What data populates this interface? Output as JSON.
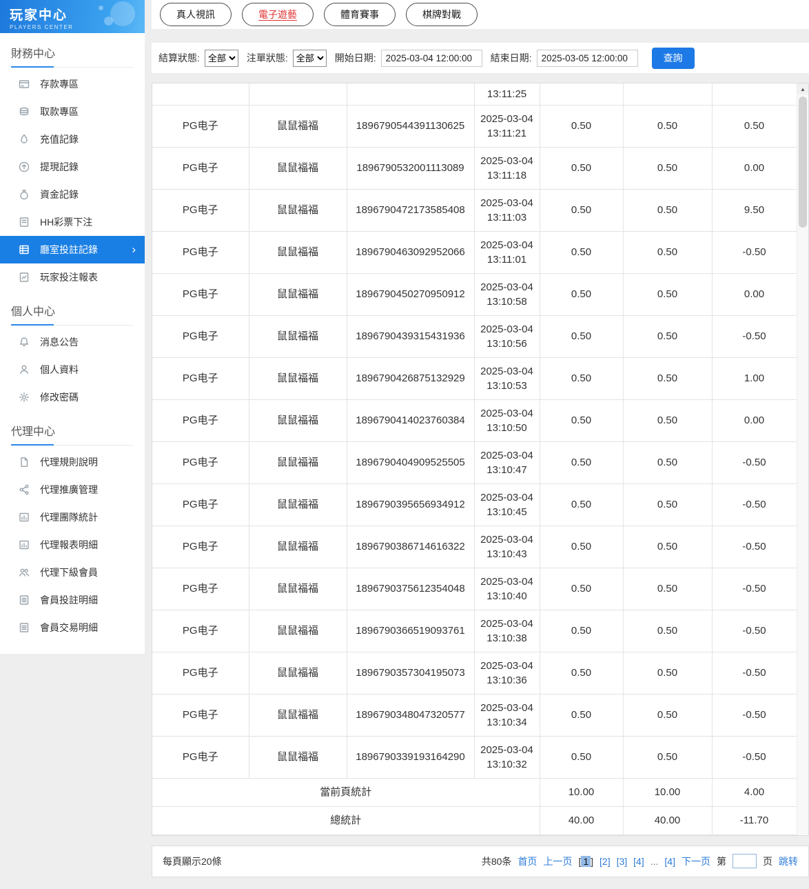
{
  "sidebar": {
    "title": "玩家中心",
    "subtitle": "PLAYERS CENTER",
    "sections": [
      {
        "label": "財務中心",
        "items": [
          {
            "label": "存款專區",
            "icon": "deposit"
          },
          {
            "label": "取款專區",
            "icon": "withdraw"
          },
          {
            "label": "充值記錄",
            "icon": "recharge"
          },
          {
            "label": "提現記錄",
            "icon": "cashout"
          },
          {
            "label": "資金記錄",
            "icon": "funds"
          },
          {
            "label": "HH彩票下注",
            "icon": "lottery"
          },
          {
            "label": "廳室投註記錄",
            "icon": "betting",
            "active": true
          },
          {
            "label": "玩家投注報表",
            "icon": "report"
          }
        ]
      },
      {
        "label": "個人中心",
        "items": [
          {
            "label": "消息公告",
            "icon": "bell"
          },
          {
            "label": "個人資料",
            "icon": "user"
          },
          {
            "label": "修改密碼",
            "icon": "gear"
          }
        ]
      },
      {
        "label": "代理中心",
        "items": [
          {
            "label": "代理規則說明",
            "icon": "doc"
          },
          {
            "label": "代理推廣管理",
            "icon": "share"
          },
          {
            "label": "代理團隊統計",
            "icon": "chart"
          },
          {
            "label": "代理報表明細",
            "icon": "chart"
          },
          {
            "label": "代理下級會員",
            "icon": "users"
          },
          {
            "label": "會員投註明細",
            "icon": "list"
          },
          {
            "label": "會員交易明細",
            "icon": "list"
          }
        ]
      }
    ]
  },
  "tabs": [
    {
      "label": "真人視訊",
      "active": false
    },
    {
      "label": "電子遊藝",
      "active": true
    },
    {
      "label": "體育賽事",
      "active": false
    },
    {
      "label": "棋牌對戰",
      "active": false
    }
  ],
  "filters": {
    "settle_status_label": "結算狀態:",
    "settle_status_value": "全部",
    "order_status_label": "注單狀態:",
    "order_status_value": "全部",
    "start_label": "開始日期:",
    "start_value": "2025-03-04 12:00:00",
    "end_label": "結束日期:",
    "end_value": "2025-03-05 12:00:00",
    "search_label": "查詢"
  },
  "table": {
    "partial_row_time": "13:11:25",
    "rows": [
      {
        "provider": "PG电子",
        "game": "鼠鼠福福",
        "order": "1896790544391130625",
        "date": "2025-03-04",
        "time": "13:11:21",
        "bet": "0.50",
        "valid": "0.50",
        "payout": "0.50"
      },
      {
        "provider": "PG电子",
        "game": "鼠鼠福福",
        "order": "1896790532001113089",
        "date": "2025-03-04",
        "time": "13:11:18",
        "bet": "0.50",
        "valid": "0.50",
        "payout": "0.00"
      },
      {
        "provider": "PG电子",
        "game": "鼠鼠福福",
        "order": "1896790472173585408",
        "date": "2025-03-04",
        "time": "13:11:03",
        "bet": "0.50",
        "valid": "0.50",
        "payout": "9.50"
      },
      {
        "provider": "PG电子",
        "game": "鼠鼠福福",
        "order": "1896790463092952066",
        "date": "2025-03-04",
        "time": "13:11:01",
        "bet": "0.50",
        "valid": "0.50",
        "payout": "-0.50"
      },
      {
        "provider": "PG电子",
        "game": "鼠鼠福福",
        "order": "1896790450270950912",
        "date": "2025-03-04",
        "time": "13:10:58",
        "bet": "0.50",
        "valid": "0.50",
        "payout": "0.00"
      },
      {
        "provider": "PG电子",
        "game": "鼠鼠福福",
        "order": "1896790439315431936",
        "date": "2025-03-04",
        "time": "13:10:56",
        "bet": "0.50",
        "valid": "0.50",
        "payout": "-0.50"
      },
      {
        "provider": "PG电子",
        "game": "鼠鼠福福",
        "order": "1896790426875132929",
        "date": "2025-03-04",
        "time": "13:10:53",
        "bet": "0.50",
        "valid": "0.50",
        "payout": "1.00"
      },
      {
        "provider": "PG电子",
        "game": "鼠鼠福福",
        "order": "1896790414023760384",
        "date": "2025-03-04",
        "time": "13:10:50",
        "bet": "0.50",
        "valid": "0.50",
        "payout": "0.00"
      },
      {
        "provider": "PG电子",
        "game": "鼠鼠福福",
        "order": "1896790404909525505",
        "date": "2025-03-04",
        "time": "13:10:47",
        "bet": "0.50",
        "valid": "0.50",
        "payout": "-0.50"
      },
      {
        "provider": "PG电子",
        "game": "鼠鼠福福",
        "order": "1896790395656934912",
        "date": "2025-03-04",
        "time": "13:10:45",
        "bet": "0.50",
        "valid": "0.50",
        "payout": "-0.50"
      },
      {
        "provider": "PG电子",
        "game": "鼠鼠福福",
        "order": "1896790386714616322",
        "date": "2025-03-04",
        "time": "13:10:43",
        "bet": "0.50",
        "valid": "0.50",
        "payout": "-0.50"
      },
      {
        "provider": "PG电子",
        "game": "鼠鼠福福",
        "order": "1896790375612354048",
        "date": "2025-03-04",
        "time": "13:10:40",
        "bet": "0.50",
        "valid": "0.50",
        "payout": "-0.50"
      },
      {
        "provider": "PG电子",
        "game": "鼠鼠福福",
        "order": "1896790366519093761",
        "date": "2025-03-04",
        "time": "13:10:38",
        "bet": "0.50",
        "valid": "0.50",
        "payout": "-0.50"
      },
      {
        "provider": "PG电子",
        "game": "鼠鼠福福",
        "order": "1896790357304195073",
        "date": "2025-03-04",
        "time": "13:10:36",
        "bet": "0.50",
        "valid": "0.50",
        "payout": "-0.50"
      },
      {
        "provider": "PG电子",
        "game": "鼠鼠福福",
        "order": "1896790348047320577",
        "date": "2025-03-04",
        "time": "13:10:34",
        "bet": "0.50",
        "valid": "0.50",
        "payout": "-0.50"
      },
      {
        "provider": "PG电子",
        "game": "鼠鼠福福",
        "order": "1896790339193164290",
        "date": "2025-03-04",
        "time": "13:10:32",
        "bet": "0.50",
        "valid": "0.50",
        "payout": "-0.50"
      }
    ],
    "page_total_label": "當前頁統計",
    "page_total": [
      "10.00",
      "10.00",
      "4.00"
    ],
    "grand_total_label": "總統計",
    "grand_total": [
      "40.00",
      "40.00",
      "-11.70"
    ]
  },
  "pagination": {
    "per_page": "每頁顯示20條",
    "total": "共80条",
    "first": "首页",
    "prev": "上一页",
    "pages": [
      {
        "label": "1",
        "current": true
      },
      {
        "label": "2"
      },
      {
        "label": "3"
      },
      {
        "label": "4"
      }
    ],
    "ellipsis": "...",
    "last_page": "4",
    "next": "下一页",
    "jump_prefix": "第",
    "jump_suffix": "页",
    "jump_label": "跳转"
  },
  "colors": {
    "accent_blue": "#1a7fe4",
    "active_tab_red": "#e03434",
    "link_blue": "#2d7cd9"
  }
}
